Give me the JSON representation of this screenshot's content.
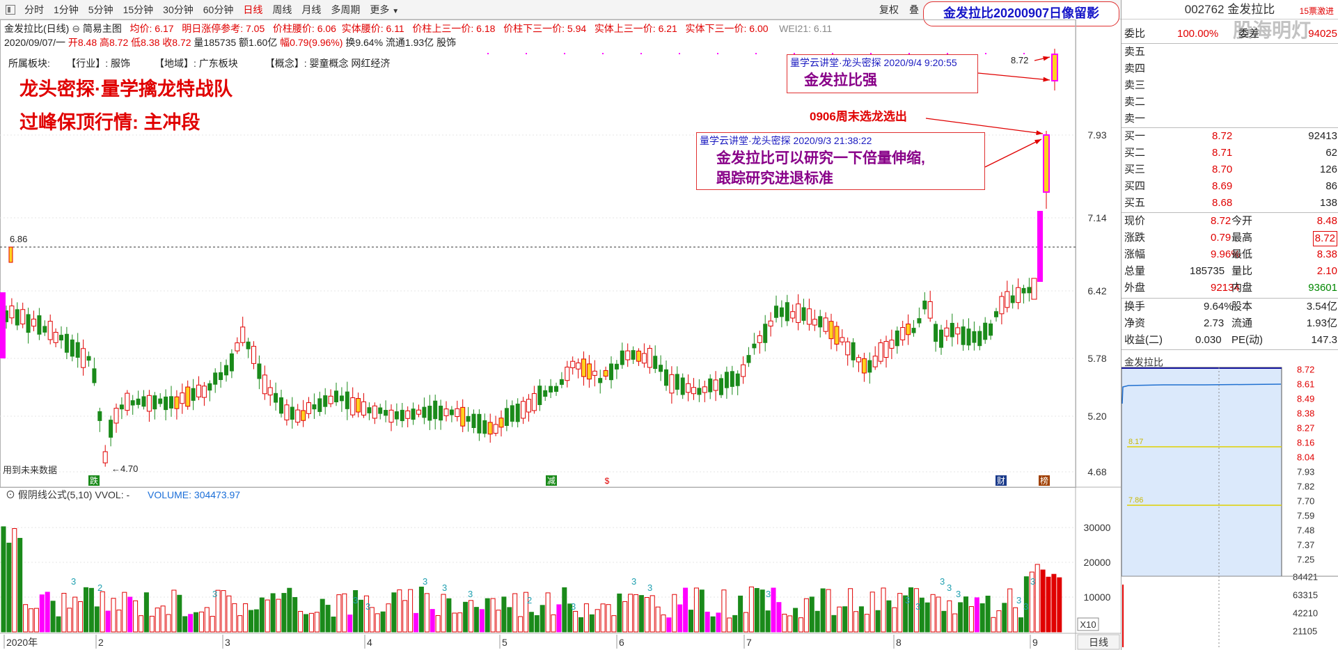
{
  "toolbar": {
    "items": [
      "分时",
      "1分钟",
      "5分钟",
      "15分钟",
      "30分钟",
      "60分钟",
      "日线",
      "周线",
      "月线",
      "多周期",
      "更多"
    ],
    "active": "日线",
    "fuquan": "复权",
    "die": "叠"
  },
  "stamp": "金发拉比20200907日像留影",
  "info": {
    "stock_title": "金发拉比(日线)",
    "mode": "简易主图",
    "avg": "均价: 6.17",
    "ref": "明日涨停参考: 7.05",
    "mid_price": "价柱腰价: 6.06",
    "body_mid": "实体腰价: 6.11",
    "upper_third": "价柱上三一价: 6.18",
    "lower_third": "价柱下三一价: 5.94",
    "body_upper": "实体上三一价: 6.21",
    "body_lower": "实体下三一价: 6.00",
    "wei": "WEI21: 6.11",
    "date": "2020/09/07/一",
    "open": "开8.48",
    "high": "高8.72",
    "low": "低8.38",
    "close": "收8.72",
    "volume": "量185735",
    "amount": "额1.60亿",
    "change": "幅0.79(9.96%)",
    "turnover": "换9.64%",
    "float": "流通1.93亿",
    "type": "股饰"
  },
  "sectors": {
    "label": "所属板块:",
    "industry": "【行业】: 服饰",
    "region": "【地域】: 广东板块",
    "concept": "【概念】: 婴童概念 网红经济"
  },
  "titles": {
    "line1": "龙头密探·量学擒龙特战队",
    "line2": "过峰保顶行情: 主冲段"
  },
  "notes": {
    "note1_header": "量学云讲堂·龙头密探 2020/9/4 9:20:55",
    "note1_body": "金发拉比强",
    "note2_header": "量学云讲堂·龙头密探 2020/9/3 21:38:22",
    "note2_line1": "金发拉比可以研究一下倍量伸缩,",
    "note2_line2": "跟踪研究进退标准",
    "annot": "0906周末选龙选出"
  },
  "price_axis": [
    "7.93",
    "7.14",
    "6.42",
    "5.78",
    "5.20",
    "4.68"
  ],
  "price_labels": {
    "high": "8.72",
    "mark": "6.86",
    "low": "4.70"
  },
  "future_note": "用到未来数据",
  "markers": [
    "跌",
    "减",
    "$",
    "财",
    "榜"
  ],
  "vol_header": {
    "title": "假阴线公式(5,10)",
    "vvol": "VVOL: -",
    "volume": "VOLUME: 304473.97"
  },
  "vol_axis": [
    "30000",
    "20000",
    "10000"
  ],
  "vol_unit": "X10",
  "vol_tags": [
    "3",
    "2",
    "3",
    "3",
    "3",
    "3",
    "3",
    "3",
    "2",
    "3",
    "3",
    "3",
    "3",
    "3",
    "3",
    "3",
    "3",
    "3",
    "3",
    "3",
    "3"
  ],
  "months": [
    "2020年",
    "2",
    "3",
    "4",
    "5",
    "6",
    "7",
    "8",
    "9"
  ],
  "period_btn": "日线",
  "panel": {
    "code": "002762",
    "name": "金发拉比",
    "watermark": "股海明灯",
    "badge": "15票激进",
    "weibi_label": "委比",
    "weibi_value": "100.00%",
    "weicha_label": "委差",
    "weicha_value": "94025",
    "sells": [
      "卖五",
      "卖四",
      "卖三",
      "卖二",
      "卖一"
    ],
    "buys": [
      {
        "label": "买一",
        "price": "8.72",
        "vol": "92413"
      },
      {
        "label": "买二",
        "price": "8.71",
        "vol": "62"
      },
      {
        "label": "买三",
        "price": "8.70",
        "vol": "126"
      },
      {
        "label": "买四",
        "price": "8.69",
        "vol": "86"
      },
      {
        "label": "买五",
        "price": "8.68",
        "vol": "138"
      }
    ],
    "stats": [
      {
        "l1": "现价",
        "v1": "8.72",
        "l2": "今开",
        "v2": "8.48"
      },
      {
        "l1": "涨跌",
        "v1": "0.79",
        "l2": "最高",
        "v2": "8.72"
      },
      {
        "l1": "涨幅",
        "v1": "9.96%",
        "l2": "最低",
        "v2": "8.38"
      },
      {
        "l1": "总量",
        "v1": "185735",
        "l2": "量比",
        "v2": "2.10"
      },
      {
        "l1": "外盘",
        "v1": "92134",
        "l2": "内盘",
        "v2": "93601"
      }
    ],
    "stats2": [
      {
        "l1": "换手",
        "v1": "9.64%",
        "l2": "股本",
        "v2": "3.54亿"
      },
      {
        "l1": "净资",
        "v1": "2.73",
        "l2": "流通",
        "v2": "1.93亿"
      },
      {
        "l1": "收益(二)",
        "v1": "0.030",
        "l2": "PE(动)",
        "v2": "147.3"
      }
    ],
    "mini_title": "金发拉比",
    "mini_prices": [
      "8.72",
      "8.61",
      "8.49",
      "8.38",
      "8.27",
      "8.16",
      "8.04",
      "7.93",
      "7.82",
      "7.70",
      "7.59",
      "7.48",
      "7.37",
      "7.25"
    ],
    "mini_vols": [
      "84421",
      "63315",
      "42210",
      "21105"
    ],
    "mini_line_labels": [
      "8.17",
      "7.86"
    ]
  }
}
